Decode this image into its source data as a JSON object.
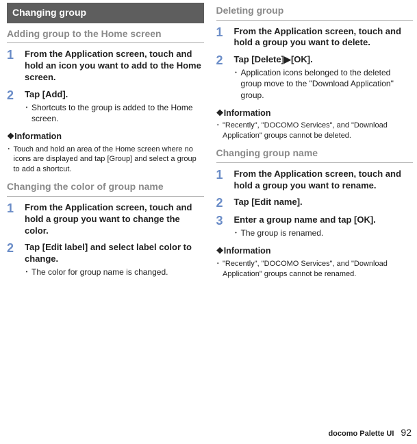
{
  "left": {
    "banner": "Changing group",
    "section1": {
      "heading": "Adding group to the Home screen",
      "step1": {
        "num": "1",
        "title": "From the Application screen, touch and hold an icon you want to add to the Home screen."
      },
      "step2": {
        "num": "2",
        "title": "Tap [Add].",
        "bullet": "Shortcuts to the group is added to the Home screen."
      },
      "info_head": "❖Information",
      "info_bullet": "Touch and hold an area of the Home screen where no icons are displayed and tap [Group] and select a group to add a shortcut."
    },
    "section2": {
      "heading": "Changing the color of group name",
      "step1": {
        "num": "1",
        "title": "From the Application screen, touch and hold a group you want to change the color."
      },
      "step2": {
        "num": "2",
        "title": "Tap [Edit label] and select label color to change.",
        "bullet": "The color for group name is changed."
      }
    }
  },
  "right": {
    "section1": {
      "heading": "Deleting group",
      "step1": {
        "num": "1",
        "title": "From the Application screen, touch and hold a group you want to delete."
      },
      "step2": {
        "num": "2",
        "title_a": "Tap [Delete]",
        "title_arrow": "▶",
        "title_b": "[OK].",
        "bullet": "Application icons belonged to the deleted group move to the \"Download Application\" group."
      },
      "info_head": "❖Information",
      "info_bullet": "\"Recently\", \"DOCOMO Services\", and \"Download Application\" groups cannot be deleted."
    },
    "section2": {
      "heading": "Changing group name",
      "step1": {
        "num": "1",
        "title": "From the Application screen, touch and hold a group you want to rename."
      },
      "step2": {
        "num": "2",
        "title": "Tap [Edit name]."
      },
      "step3": {
        "num": "3",
        "title": "Enter a group name and tap [OK].",
        "bullet": "The group is renamed."
      },
      "info_head": "❖Information",
      "info_bullet": "\"Recently\", \"DOCOMO Services\", and \"Download Application\" groups cannot be renamed."
    }
  },
  "footer": {
    "label": "docomo Palette UI",
    "page": "92"
  }
}
